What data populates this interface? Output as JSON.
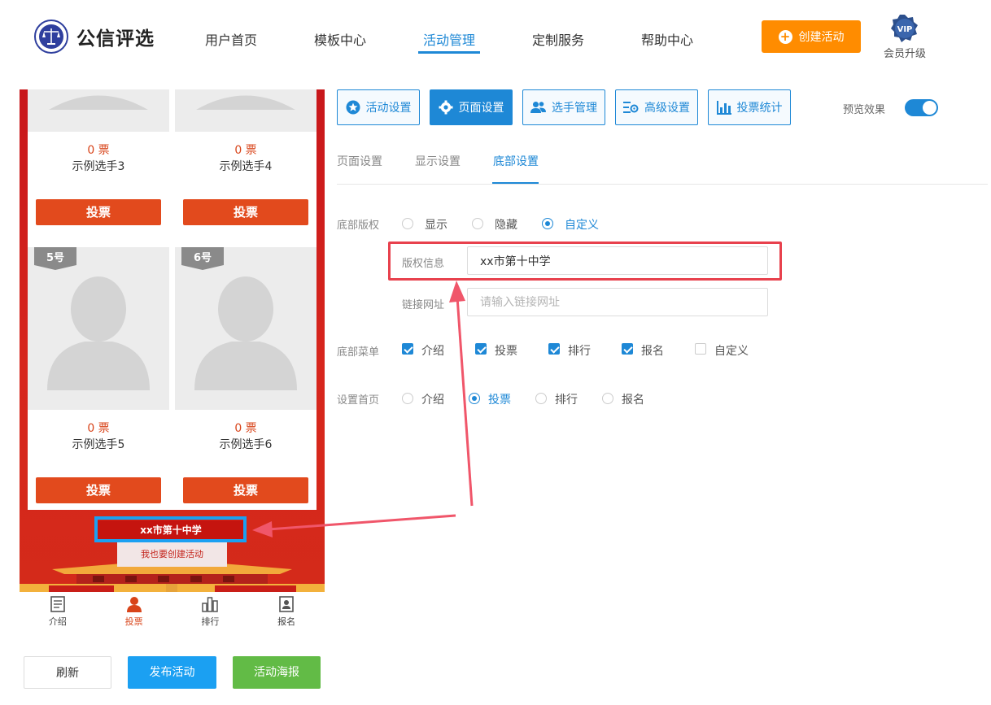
{
  "brand": {
    "name": "公信评选"
  },
  "nav": {
    "items": [
      "用户首页",
      "模板中心",
      "活动管理",
      "定制服务",
      "帮助中心"
    ],
    "active_index": 2,
    "create_label": "创建活动",
    "vip_badge": "VIP",
    "vip_label": "会员升级"
  },
  "preview": {
    "candidates": [
      {
        "votes": "0 票",
        "name": "示例选手3",
        "vote_label": "投票"
      },
      {
        "votes": "0 票",
        "name": "示例选手4",
        "vote_label": "投票"
      },
      {
        "number": "5号",
        "votes": "0 票",
        "name": "示例选手5",
        "vote_label": "投票"
      },
      {
        "number": "6号",
        "votes": "0 票",
        "name": "示例选手6",
        "vote_label": "投票"
      }
    ],
    "copyright_text": "xx市第十中学",
    "also_create": "我也要创建活动",
    "tabbar": [
      {
        "label": "介绍",
        "icon": "intro-icon"
      },
      {
        "label": "投票",
        "icon": "user-icon"
      },
      {
        "label": "排行",
        "icon": "ranking-icon"
      },
      {
        "label": "报名",
        "icon": "signup-icon"
      }
    ],
    "tabbar_active": 1
  },
  "actions": {
    "refresh": "刷新",
    "publish": "发布活动",
    "poster": "活动海报"
  },
  "toolbar": {
    "buttons": [
      {
        "label": "活动设置",
        "icon": "star-icon"
      },
      {
        "label": "页面设置",
        "icon": "gear-icon"
      },
      {
        "label": "选手管理",
        "icon": "users-icon"
      },
      {
        "label": "高级设置",
        "icon": "settings-list-icon"
      },
      {
        "label": "投票统计",
        "icon": "bar-chart-icon"
      }
    ],
    "active_index": 1,
    "preview_label": "预览效果",
    "preview_on": true
  },
  "subtabs": {
    "items": [
      "页面设置",
      "显示设置",
      "底部设置"
    ],
    "active_index": 2
  },
  "footer_settings": {
    "copyright_row": {
      "label": "底部版权",
      "options": [
        "显示",
        "隐藏",
        "自定义"
      ],
      "selected": "自定义"
    },
    "copyright_info": {
      "label": "版权信息",
      "value": "xx市第十中学"
    },
    "link_url": {
      "label": "链接网址",
      "placeholder": "请输入链接网址"
    },
    "menu_row": {
      "label": "底部菜单",
      "options": [
        "介绍",
        "投票",
        "排行",
        "报名",
        "自定义"
      ],
      "checked": [
        "介绍",
        "投票",
        "排行",
        "报名"
      ]
    },
    "home_row": {
      "label": "设置首页",
      "options": [
        "介绍",
        "投票",
        "排行",
        "报名"
      ],
      "selected": "投票"
    }
  },
  "colors": {
    "accent": "#1e88d6",
    "brand_orange": "#ff8c00",
    "vote_red": "#e24a1d",
    "poster_green": "#62bb46",
    "highlight_red": "#e8414d",
    "highlight_blue": "#1ba0f2"
  }
}
